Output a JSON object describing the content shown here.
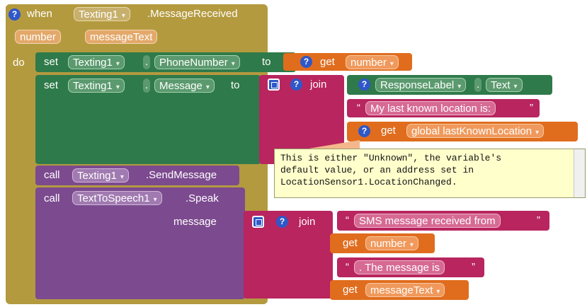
{
  "event": {
    "when": "when",
    "component": "Texting1",
    "event_name": ".MessageReceived",
    "param1": "number",
    "param2": "messageText",
    "do": "do"
  },
  "set_phone": {
    "set": "set",
    "component": "Texting1",
    "dot": ".",
    "property": "PhoneNumber",
    "to": "to",
    "get": "get",
    "var": "number"
  },
  "set_message": {
    "set": "set",
    "component": "Texting1",
    "dot": ".",
    "property": "Message",
    "to": "to",
    "join": "join",
    "component2": "ResponseLabel",
    "dot2": ".",
    "property2": "Text",
    "string1": "My last known location is:",
    "get": "get",
    "global_var": "global lastKnownLocation"
  },
  "tooltip": {
    "line1": "This is either \"Unknown\", the variable's",
    "line2": "default value, or an address set in",
    "line3": "LocationSensor1.LocationChanged."
  },
  "call_send": {
    "call": "call",
    "component": "Texting1",
    "method": ".SendMessage"
  },
  "call_speak": {
    "call": "call",
    "component": "TextToSpeech1",
    "method": ".Speak",
    "message": "message",
    "join": "join",
    "string1": "SMS message received from",
    "get1": "get",
    "var1": "number",
    "string2": ". The message is",
    "get2": "get",
    "var2": "messageText"
  },
  "glyphs": {
    "dropdown": "▾",
    "quote_open": "“",
    "quote_close": "”",
    "help": "?"
  },
  "colors": {
    "event": "#b49a3f",
    "set": "#2f7a4a",
    "get": "#e06d1e",
    "text": "#b8255f",
    "call": "#7c4a8f",
    "help": "#2f57c8"
  }
}
